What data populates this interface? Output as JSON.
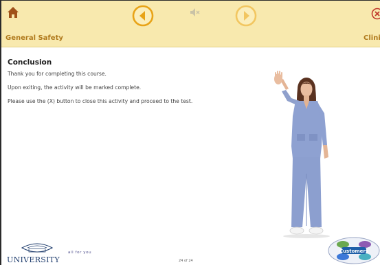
{
  "header": {
    "course_title": "General Safety",
    "section_title": "Clinical",
    "home_icon": "home-icon",
    "prev_icon": "back-arrow-icon",
    "mute_icon": "speaker-muted-icon",
    "next_icon": "forward-arrow-icon",
    "close_icon": "close-x-icon"
  },
  "content": {
    "heading": "Conclusion",
    "paragraphs": [
      "Thank you for completing this course.",
      "Upon exiting, the activity will be marked complete.",
      "Please use the (X) button to close this activity and proceed to the test."
    ]
  },
  "footer": {
    "logo_text": "UNIVERSITY",
    "tagline": "all for you",
    "page_counter": "24 of 24",
    "badge_label": "Customers"
  },
  "colors": {
    "header_bg": "#f8e9ae",
    "accent": "#e8a317",
    "icon_brown": "#a0521a",
    "close_red": "#c0392b"
  }
}
